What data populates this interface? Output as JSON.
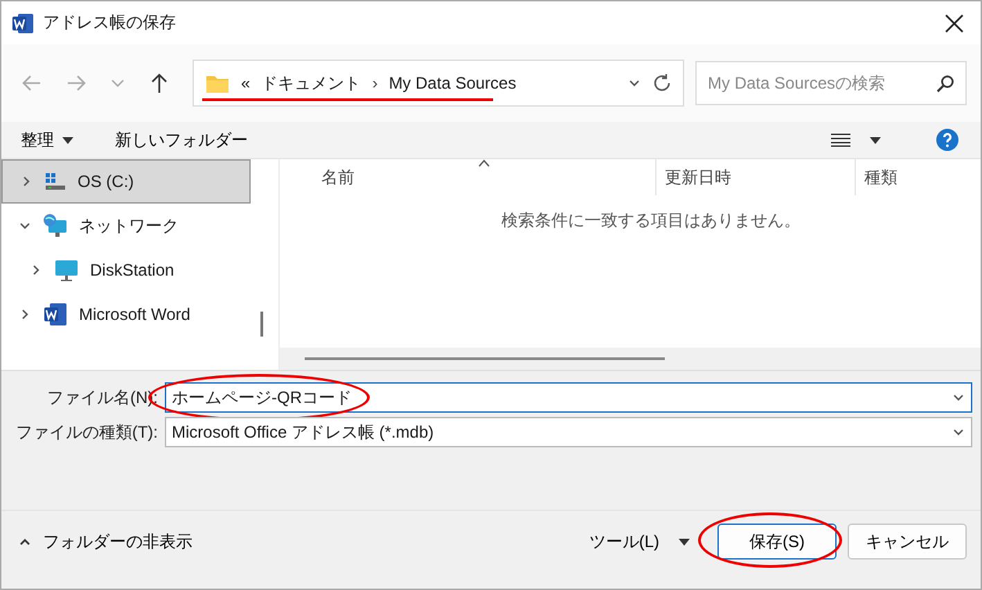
{
  "window": {
    "title": "アドレス帳の保存"
  },
  "nav": {
    "breadcrumb": [
      {
        "label": "«",
        "kind": "crumb"
      },
      {
        "label": "ドキュメント",
        "kind": "crumb"
      },
      {
        "label": "›",
        "kind": "separator"
      },
      {
        "label": "My Data Sources",
        "kind": "crumb"
      }
    ],
    "highlighted": true,
    "search": {
      "placeholder": "My Data Sourcesの検索"
    }
  },
  "commands": {
    "organize": "整理",
    "new_folder": "新しいフォルダー"
  },
  "tree": [
    {
      "label": "OS (C:)",
      "kind": "drive",
      "selected": true,
      "expanded": false
    },
    {
      "label": "ネットワーク",
      "kind": "network",
      "selected": false,
      "expanded": true,
      "children": [
        {
          "label": "DiskStation",
          "kind": "monitor",
          "selected": false,
          "expanded": false
        }
      ]
    },
    {
      "label": "Microsoft Word",
      "kind": "word",
      "selected": false,
      "expanded": false
    }
  ],
  "table": {
    "columns": [
      {
        "label": "名前",
        "sorted": true
      },
      {
        "label": "更新日時",
        "sorted": false
      },
      {
        "label": "種類",
        "sorted": false
      }
    ],
    "empty_message": "検索条件に一致する項目はありません。"
  },
  "fields": [
    {
      "label": "ファイル名(N):",
      "value": "ホームページ-QRコード",
      "highlighted": true,
      "focused": true
    },
    {
      "label": "ファイルの種類(T):",
      "value": "Microsoft Office アドレス帳 (*.mdb)",
      "highlighted": false,
      "focused": false
    }
  ],
  "footer": {
    "hide_folders": "フォルダーの非表示",
    "tools": "ツール(L)",
    "buttons": [
      {
        "label": "保存(S)",
        "kind": "primary",
        "highlighted": true
      },
      {
        "label": "キャンセル",
        "kind": "normal",
        "highlighted": false
      }
    ]
  }
}
